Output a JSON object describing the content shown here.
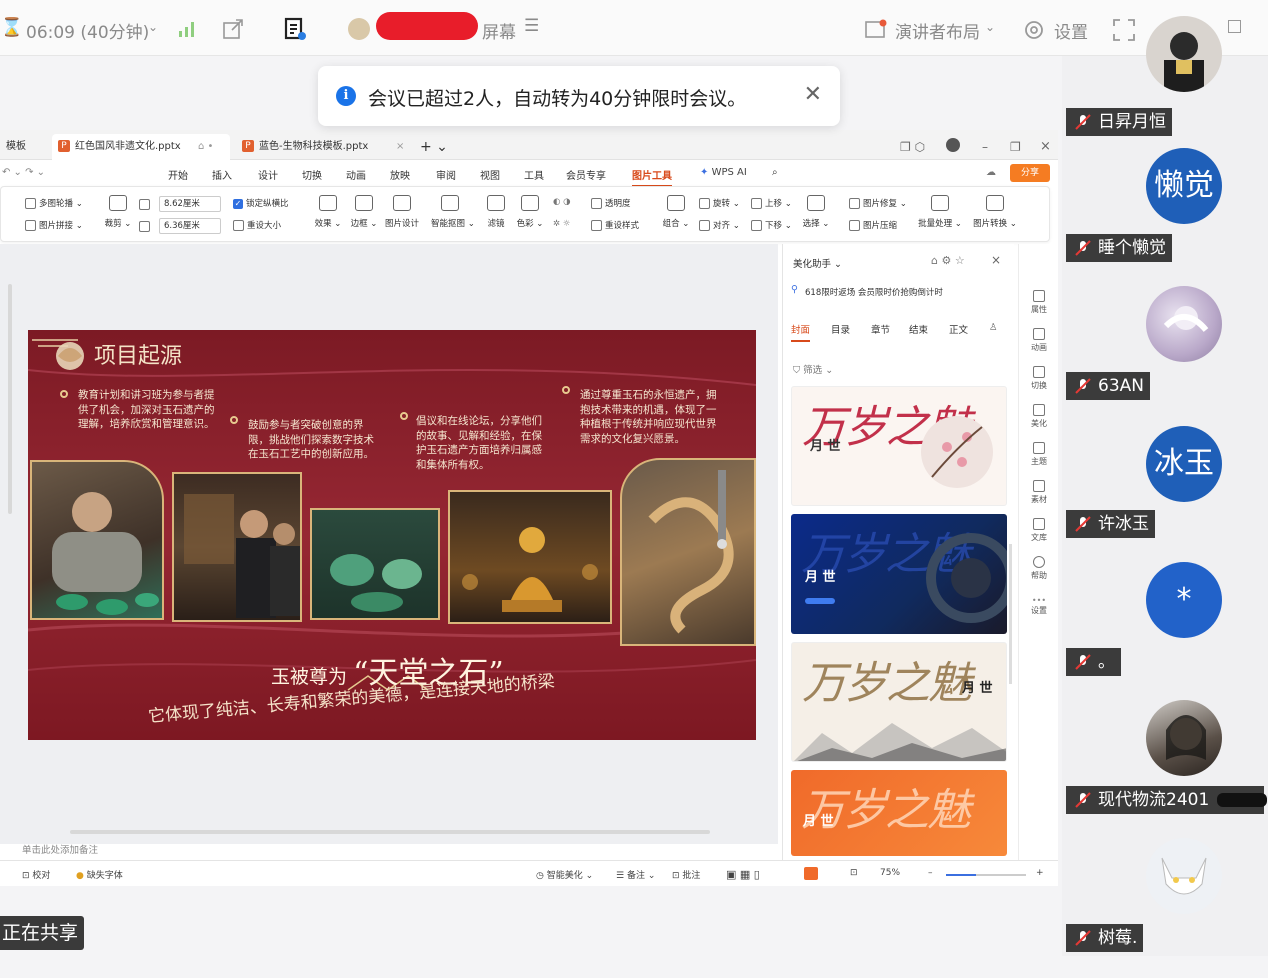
{
  "topbar": {
    "timer": "06:09 (40分钟)",
    "share_title_suffix": "屏幕",
    "presenter_layout": "演讲者布局",
    "settings": "设置"
  },
  "notice": {
    "message": "会议已超过2人，自动转为40分钟限时会议。"
  },
  "wps": {
    "tabs": [
      {
        "label": "模板"
      },
      {
        "label": "红色国风非遗文化.pptx"
      },
      {
        "label": "蓝色-生物科技模板.pptx"
      }
    ],
    "menu": [
      "开始",
      "插入",
      "设计",
      "切换",
      "动画",
      "放映",
      "审阅",
      "视图",
      "工具",
      "会员专享",
      "图片工具",
      "WPS AI"
    ],
    "active_menu": "图片工具",
    "share_label": "分享",
    "ribbon": {
      "multi_crop": "多图轮播",
      "image_join": "图片拼接",
      "crop": "裁剪",
      "width": "8.62厘米",
      "height": "6.36厘米",
      "lock_ratio": "锁定纵横比",
      "reset_size": "重设大小",
      "effect": "效果",
      "border": "边框",
      "image_design": "图片设计",
      "smart_crop": "智能抠图",
      "filter": "滤镜",
      "color": "色彩",
      "transparency": "透明度",
      "reset_style": "重设样式",
      "group": "组合",
      "rotate": "旋转",
      "align": "对齐",
      "up": "上移",
      "down": "下移",
      "select": "选择",
      "image_repair": "图片修复",
      "compress": "图片压缩",
      "batch": "批量处理",
      "convert": "图片转换"
    },
    "slide": {
      "title": "项目起源",
      "paragraphs": [
        "教育计划和讲习班为参与者提供了机会，加深对玉石遗产的理解，培养欣赏和管理意识。",
        "鼓励参与者突破创意的界限，挑战他们探索数字技术在玉石工艺中的创新应用。",
        "倡议和在线论坛，分享他们的故事、见解和经验，在保护玉石遗产方面培养归属感和集体所有权。",
        "通过尊重玉石的永恒遗产，拥抱技术带来的机遇，体现了一种植根于传统并响应现代世界需求的文化复兴愿景。"
      ],
      "quote_prefix": "玉被尊为",
      "quote_main": "“天堂之石”",
      "subline": "它体现了纯洁、长寿和繁荣的美德，是连接天地的桥梁"
    },
    "note_placeholder": "单击此处添加备注",
    "status": {
      "proofread": "校对",
      "missing_font": "缺失字体",
      "smart_beautify": "智能美化",
      "notes": "备注",
      "comments": "批注",
      "zoom": "75%"
    },
    "panel": {
      "title": "美化助手",
      "promo": "618限时返场 会员限时价抢购倒计时",
      "tabs": [
        "封面",
        "目录",
        "章节",
        "结束",
        "正文"
      ],
      "active_tab": "封面",
      "filter": "筛选",
      "thumbs": [
        {
          "title": "万岁之魅",
          "sub": "月 世"
        },
        {
          "title": "万岁之魅",
          "sub": "月 世"
        },
        {
          "title": "万岁之魅",
          "sub": "月 世"
        },
        {
          "title": "万岁之魅",
          "sub": "月 世"
        }
      ]
    },
    "side_tools": [
      "属性",
      "动画",
      "切换",
      "美化",
      "主题",
      "素材",
      "文库",
      "帮助",
      "设置"
    ]
  },
  "sharing_label": "正在共享",
  "participants": [
    {
      "name": "日昇月恒",
      "avatar_text": ""
    },
    {
      "name": "睡个懒觉",
      "avatar_text": "懒觉"
    },
    {
      "name": "63AN",
      "avatar_text": ""
    },
    {
      "name": "许冰玉",
      "avatar_text": "冰玉"
    },
    {
      "name": "。",
      "avatar_text": "*"
    },
    {
      "name": "现代物流2401",
      "avatar_text": ""
    },
    {
      "name": "树莓.",
      "avatar_text": ""
    }
  ],
  "colors": {
    "accent_orange": "#d84a1b",
    "slide_red": "#8a1e28",
    "avatar_blue": "#1f5fb8",
    "info_blue": "#1a73e8"
  }
}
